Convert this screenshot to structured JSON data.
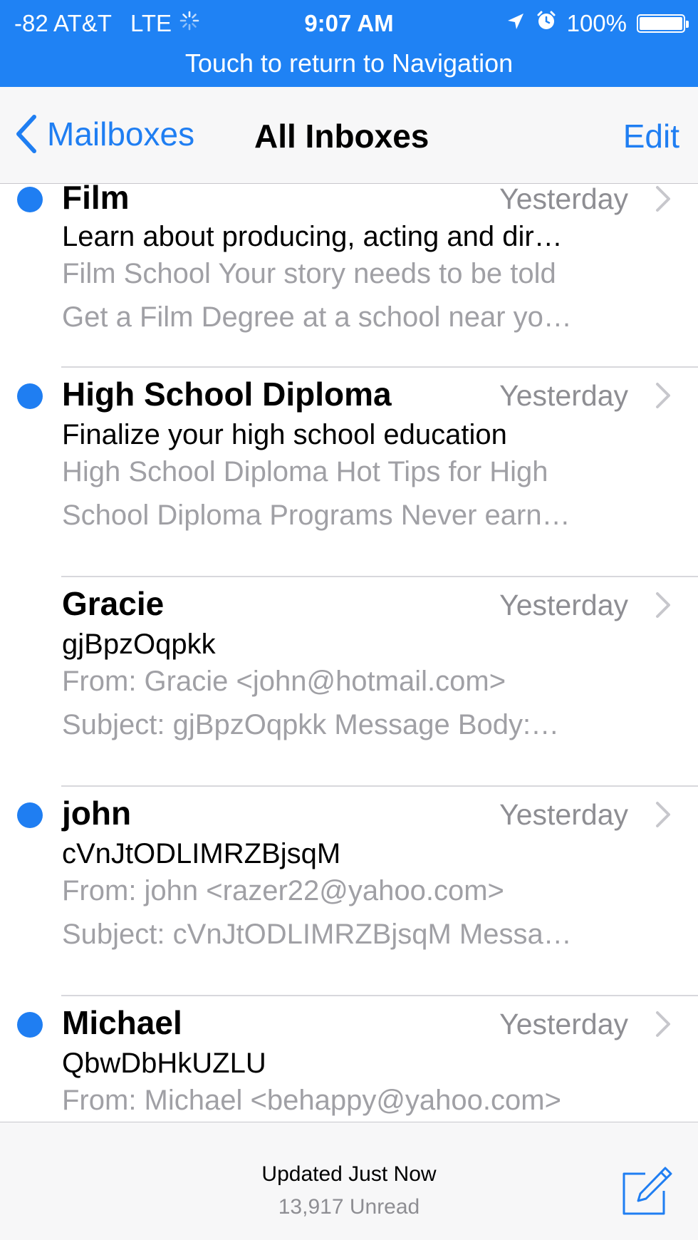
{
  "status_bar": {
    "carrier": "-82 AT&T",
    "network": "LTE",
    "time": "9:07 AM",
    "battery": "100%",
    "battery_level": 1.0,
    "banner": "Touch to return to Navigation"
  },
  "navbar": {
    "back_label": "Mailboxes",
    "title": "All Inboxes",
    "edit_label": "Edit"
  },
  "messages": [
    {
      "sender": "Film",
      "date": "Yesterday",
      "subject": "Learn about producing, acting and dir…",
      "preview1": "Film School Your story needs to be told",
      "preview2": "Get a Film Degree at a school near yo…",
      "unread": true
    },
    {
      "sender": "High School Diploma",
      "date": "Yesterday",
      "subject": "Finalize your high school education",
      "preview1": "High School Diploma Hot Tips for High",
      "preview2": "School Diploma Programs Never earn…",
      "unread": true
    },
    {
      "sender": "Gracie",
      "date": "Yesterday",
      "subject": "gjBpzOqpkk",
      "preview1": "From: Gracie <john@hotmail.com>",
      "preview2": "Subject: gjBpzOqpkk Message Body:…",
      "unread": false
    },
    {
      "sender": "john",
      "date": "Yesterday",
      "subject": "cVnJtODLIMRZBjsqM",
      "preview1": "From: john <razer22@yahoo.com>",
      "preview2": "Subject: cVnJtODLIMRZBjsqM Messa…",
      "unread": true
    },
    {
      "sender": "Michael",
      "date": "Yesterday",
      "subject": "QbwDbHkUZLU",
      "preview1": "From: Michael <behappy@yahoo.com>",
      "preview2": "",
      "unread": true
    }
  ],
  "toolbar": {
    "updated": "Updated Just Now",
    "unread_count": "13,917 Unread"
  },
  "colors": {
    "accent": "#1f7ef2",
    "status_bar": "#1f82f4",
    "secondary_text": "#8e8e93",
    "preview_text": "#a0a0a5"
  },
  "icons": {
    "activity": "activity-spinner-icon",
    "location": "location-arrow-icon",
    "alarm": "alarm-clock-icon",
    "battery": "battery-icon",
    "back": "chevron-left-icon",
    "disclosure": "chevron-right-icon",
    "compose": "compose-icon"
  }
}
